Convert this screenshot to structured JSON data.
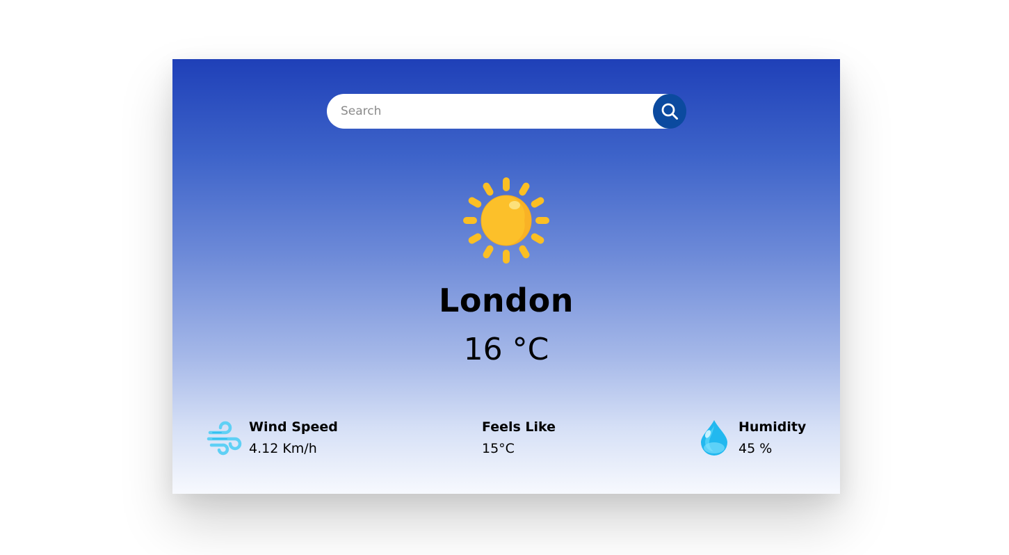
{
  "search": {
    "placeholder": "Search",
    "value": ""
  },
  "weather": {
    "icon": "sun-icon",
    "city": "London",
    "temperature": "16 °C"
  },
  "stats": {
    "wind": {
      "icon": "wind-icon",
      "label": "Wind Speed",
      "value": "4.12 Km/h"
    },
    "feels_like": {
      "label": "Feels Like",
      "value": "15°C"
    },
    "humidity": {
      "icon": "water-drop-icon",
      "label": "Humidity",
      "value": "45 %"
    }
  },
  "colors": {
    "gradient_top": "#1f40b8",
    "gradient_bottom": "#f7f9fe",
    "search_button": "#0b4a9f",
    "sun": "#fbbf24",
    "wind_icon": "#5fd0f5",
    "drop_icon": "#22b8ef"
  }
}
